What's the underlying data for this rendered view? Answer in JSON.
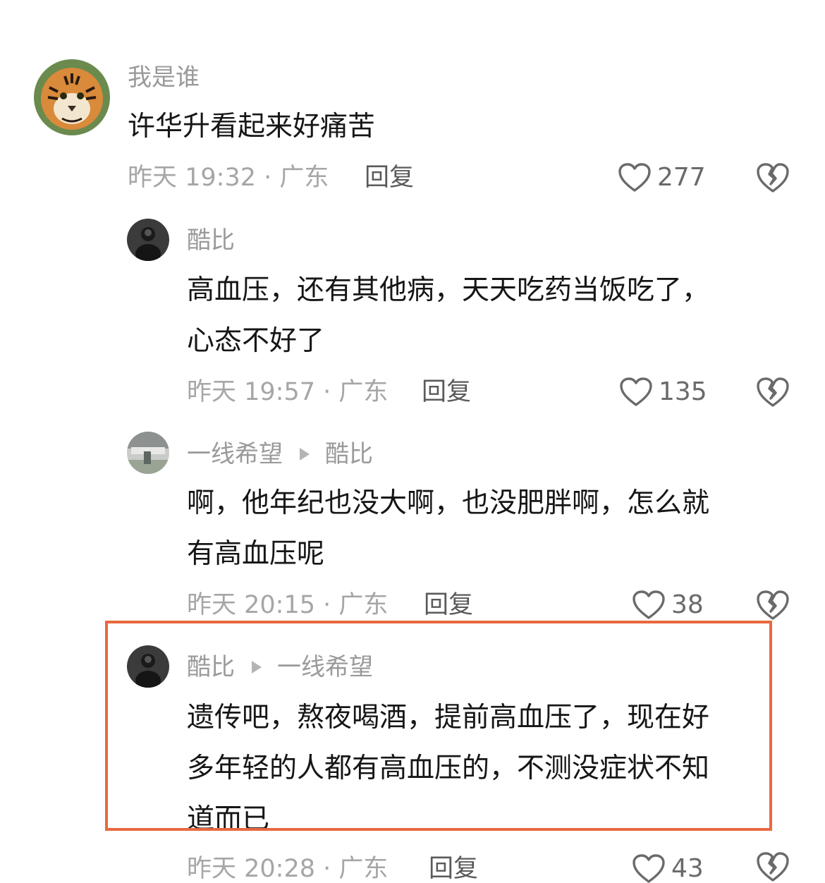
{
  "comments": [
    {
      "user": "我是谁",
      "text_lines": [
        "许华升看起来好痛苦"
      ],
      "time_location": "昨天 19:32 · 广东",
      "reply_label": "回复",
      "likes": "277",
      "avatar_icon": "tiger-avatar-icon"
    },
    {
      "user": "酷比",
      "text_lines": [
        "高血压，还有其他病，天天吃药当饭吃了，",
        "心态不好了"
      ],
      "time_location": "昨天 19:57 · 广东",
      "reply_label": "回复",
      "likes": "135",
      "avatar_icon": "dark-avatar-icon"
    },
    {
      "user": "一线希望",
      "reply_to": "酷比",
      "text_lines": [
        "啊，他年纪也没大啊，也没肥胖啊，怎么就",
        "有高血压呢"
      ],
      "time_location": "昨天 20:15 · 广东",
      "reply_label": "回复",
      "likes": "38",
      "avatar_icon": "photo-avatar-icon"
    },
    {
      "user": "酷比",
      "reply_to": "一线希望",
      "text_lines": [
        "遗传吧，熬夜喝酒，提前高血压了，现在好",
        "多年轻的人都有高血压的，不测没症状不知",
        "道而已"
      ],
      "time_location": "昨天 20:28 · 广东",
      "reply_label": "回复",
      "likes": "43",
      "avatar_icon": "dark-avatar-icon"
    }
  ],
  "colors": {
    "highlight_border": "#e8693f",
    "text_primary": "#161616",
    "text_secondary": "#9a9a9a"
  }
}
